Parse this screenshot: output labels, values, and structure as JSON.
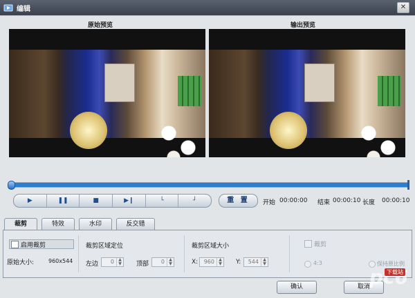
{
  "window": {
    "title": "编辑"
  },
  "preview": {
    "original_label": "原始预览",
    "output_label": "输出预览"
  },
  "playback": {
    "reset_label": "重 置",
    "start_label": "开始",
    "start_time": "00:00:00",
    "end_label": "结束",
    "end_time": "00:00:10",
    "length_label": "长度",
    "length_time": "00:00:10",
    "progress": 0
  },
  "tabs": [
    "裁剪",
    "特效",
    "水印",
    "反交错"
  ],
  "crop": {
    "enable_label": "启用裁剪",
    "original_size_label": "原始大小:",
    "original_size_value": "960x544",
    "position_title": "裁剪区域定位",
    "left_label": "左边",
    "left_value": "0",
    "top_label": "顶部",
    "top_value": "0",
    "size_title": "裁剪区域大小",
    "x_label": "X:",
    "x_value": "960",
    "y_label": "Y:",
    "y_value": "544",
    "crop_option_label": "裁剪",
    "ratio_4_3": "4:3",
    "keep_ratio_label": "保持原比例"
  },
  "buttons": {
    "ok": "确认",
    "cancel": "取消"
  },
  "watermark": {
    "logo": "pc6",
    "sub": "下载站"
  }
}
